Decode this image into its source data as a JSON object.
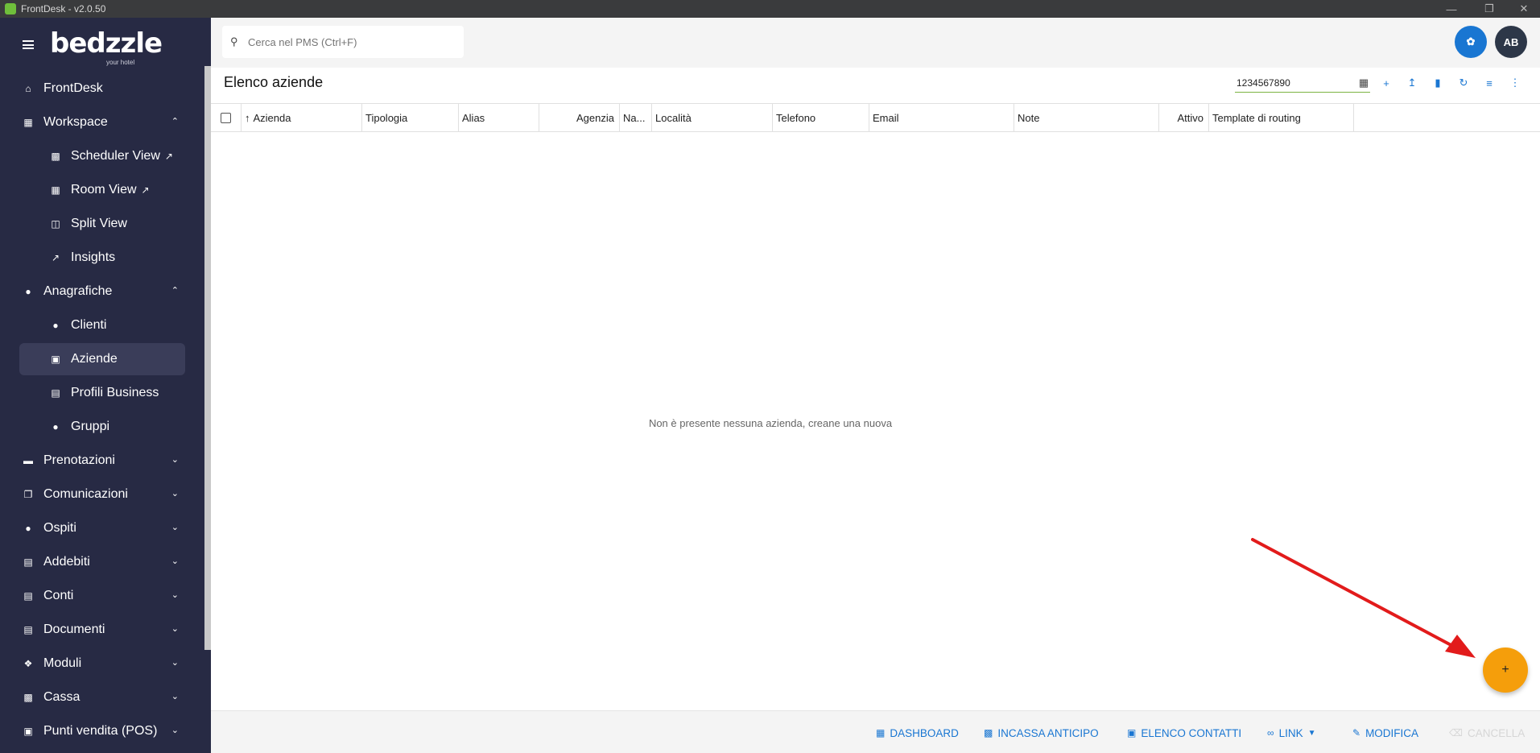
{
  "window": {
    "title": "FrontDesk - v2.0.50"
  },
  "brand": {
    "logo": "bedzzle",
    "tagline": "your hotel"
  },
  "search": {
    "placeholder": "Cerca nel PMS (Ctrl+F)"
  },
  "user": {
    "initials": "AB"
  },
  "colors": {
    "sidebar": "#272a44",
    "accent": "#1976d2",
    "fab": "#f59e0b",
    "arrow": "#e21b1b"
  },
  "sidebar": {
    "items": [
      {
        "label": "FrontDesk",
        "icon": "home-icon"
      },
      {
        "label": "Workspace",
        "icon": "dashboard-icon",
        "expanded": true
      },
      {
        "label": "Scheduler View",
        "icon": "calendar-icon",
        "external": true
      },
      {
        "label": "Room View",
        "icon": "grid-icon",
        "external": true
      },
      {
        "label": "Split View",
        "icon": "split-icon"
      },
      {
        "label": "Insights",
        "icon": "chart-icon"
      },
      {
        "label": "Anagrafiche",
        "icon": "person-icon",
        "expanded": true
      },
      {
        "label": "Clienti",
        "icon": "person-icon"
      },
      {
        "label": "Aziende",
        "icon": "building-icon",
        "active": true
      },
      {
        "label": "Profili Business",
        "icon": "business-icon"
      },
      {
        "label": "Gruppi",
        "icon": "group-icon"
      },
      {
        "label": "Prenotazioni",
        "icon": "bed-icon"
      },
      {
        "label": "Comunicazioni",
        "icon": "copy-icon"
      },
      {
        "label": "Ospiti",
        "icon": "guest-icon"
      },
      {
        "label": "Addebiti",
        "icon": "list-icon"
      },
      {
        "label": "Conti",
        "icon": "account-icon"
      },
      {
        "label": "Documenti",
        "icon": "document-icon"
      },
      {
        "label": "Moduli",
        "icon": "puzzle-icon"
      },
      {
        "label": "Cassa",
        "icon": "cash-icon"
      },
      {
        "label": "Punti vendita (POS)",
        "icon": "bag-icon"
      }
    ]
  },
  "main": {
    "title": "Elenco aziende",
    "filter_value": "1234567890",
    "columns": [
      "Azienda",
      "Tipologia",
      "Alias",
      "Agenzia",
      "Na...",
      "Località",
      "Telefono",
      "Email",
      "Note",
      "Attivo",
      "Template di routing"
    ],
    "empty_message": "Non è presente nessuna azienda, creane una nuova",
    "fab_label": "+"
  },
  "bottom": {
    "dashboard": "DASHBOARD",
    "incassa": "INCASSA ANTICIPO",
    "contatti": "ELENCO CONTATTI",
    "link": "LINK",
    "modifica": "MODIFICA",
    "cancella": "CANCELLA"
  }
}
